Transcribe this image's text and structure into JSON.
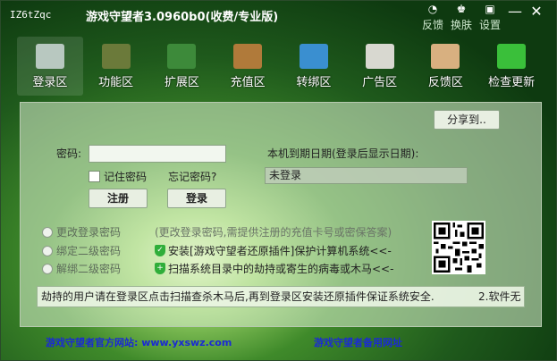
{
  "window": {
    "app_id": "IZ6tZqc",
    "title": "游戏守望者3.0960b0(收费/专业版)"
  },
  "title_tools": [
    {
      "icon": "feedback-icon",
      "glyph": "◔",
      "label": "反馈"
    },
    {
      "icon": "skin-icon",
      "glyph": "♚",
      "label": "换肤"
    },
    {
      "icon": "settings-icon",
      "glyph": "▣",
      "label": "设置"
    }
  ],
  "window_controls": {
    "minimize": "—",
    "close": "✕"
  },
  "toolbar": [
    {
      "label": "登录区",
      "icon": "chain-link-icon",
      "color": "#b8c8c0",
      "active": true
    },
    {
      "label": "功能区",
      "icon": "chip-icon",
      "color": "#6b7a3a"
    },
    {
      "label": "扩展区",
      "icon": "memory-icon",
      "color": "#3d8a3a"
    },
    {
      "label": "充值区",
      "icon": "wallet-icon",
      "color": "#b07a3a"
    },
    {
      "label": "转绑区",
      "icon": "monitor-icon",
      "color": "#3a8fd0"
    },
    {
      "label": "广告区",
      "icon": "newspaper-icon",
      "color": "#d8d8d0"
    },
    {
      "label": "反馈区",
      "icon": "envelope-icon",
      "color": "#d8b080"
    },
    {
      "label": "检查更新",
      "icon": "checkbox-icon",
      "color": "#3abf3a"
    }
  ],
  "login": {
    "share_button": "分享到..",
    "password_label": "密码:",
    "password_value": "",
    "remember_label": "记住密码",
    "forgot_label": "忘记密码?",
    "register_button": "注册",
    "login_button": "登录",
    "expire_label": "本机到期日期(登录后显示日期):",
    "expire_value": "未登录"
  },
  "options": [
    {
      "label": "更改登录密码",
      "hint": "(更改登录密码,需提供注册的充值卡号或密保答案)"
    },
    {
      "label": "绑定二级密码",
      "hint": "安装[游戏守望者还原插件]保护计算机系统<<-"
    },
    {
      "label": "解绑二级密码",
      "hint": "扫描系统目录中的劫持或寄生的病毒或木马<<-"
    }
  ],
  "notice": {
    "text": "劫持的用户请在登录区点击扫描查杀木马后,再到登录区安装还原插件保证系统安全.",
    "extra": "2.软件无"
  },
  "footer": {
    "official_site": "游戏守望者官方网站: www.yxswz.com",
    "backup_site": "游戏守望者备用网址"
  }
}
